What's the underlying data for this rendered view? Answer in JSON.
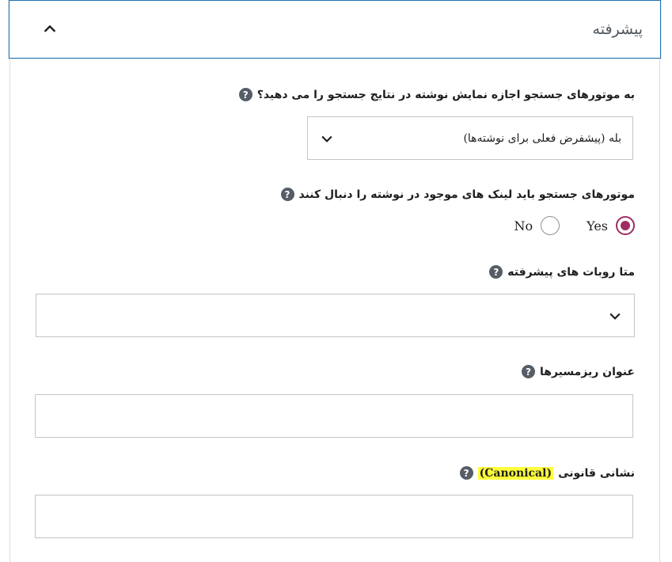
{
  "panel": {
    "title": "پیشرفته"
  },
  "fields": {
    "robots_index": {
      "label": "به موتورهای جستجو اجازه نمایش نوشته در نتایج جستجو را می دهید؟",
      "help": "?",
      "selected_value": "بله (پیشفرض فعلی برای نوشته‌ها)"
    },
    "robots_follow": {
      "label": "موتورهای جستجو باید لینک های موجود در نوشته را دنبال کنند",
      "help": "?",
      "options": [
        {
          "label": "Yes",
          "checked": true
        },
        {
          "label": "No",
          "checked": false
        }
      ]
    },
    "meta_robots": {
      "label": "متا روبات های پیشرفته",
      "help": "?",
      "selected_value": ""
    },
    "breadcrumb_title": {
      "label": "عنوان ریزمسیرها",
      "help": "?",
      "value": ""
    },
    "canonical": {
      "label_prefix": "نشانی قانونی",
      "label_highlight": "(Canonical)",
      "help": "?",
      "value": ""
    }
  },
  "colors": {
    "focus_border": "#2271b1",
    "radio_accent": "#9d2d63",
    "highlight": "#ffff3c"
  },
  "icons": {
    "panel_toggle": "chevron-up-icon",
    "select_arrow": "chevron-down-icon",
    "help": "question-circle-icon"
  }
}
